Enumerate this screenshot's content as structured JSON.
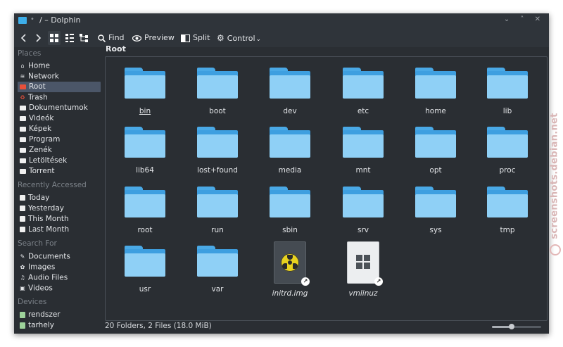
{
  "window": {
    "title": "/ – Dolphin"
  },
  "toolbar": {
    "find_label": "Find",
    "preview_label": "Preview",
    "split_label": "Split",
    "control_label": "Control"
  },
  "sidebar": {
    "places_header": "Places",
    "places": [
      {
        "label": "Home",
        "icon": "home-icon"
      },
      {
        "label": "Network",
        "icon": "network-icon"
      },
      {
        "label": "Root",
        "icon": "red-folder-icon",
        "selected": true
      },
      {
        "label": "Trash",
        "icon": "trash-icon"
      },
      {
        "label": "Dokumentumok",
        "icon": "folder-icon"
      },
      {
        "label": "Videók",
        "icon": "folder-icon"
      },
      {
        "label": "Képek",
        "icon": "folder-icon"
      },
      {
        "label": "Program",
        "icon": "folder-icon"
      },
      {
        "label": "Zenék",
        "icon": "folder-icon"
      },
      {
        "label": "Letöltések",
        "icon": "folder-icon"
      },
      {
        "label": "Torrent",
        "icon": "folder-icon"
      }
    ],
    "recent_header": "Recently Accessed",
    "recent": [
      {
        "label": "Today",
        "icon": "calendar-icon"
      },
      {
        "label": "Yesterday",
        "icon": "calendar-icon"
      },
      {
        "label": "This Month",
        "icon": "calendar-icon"
      },
      {
        "label": "Last Month",
        "icon": "calendar-icon"
      }
    ],
    "search_header": "Search For",
    "search": [
      {
        "label": "Documents",
        "icon": "document-icon"
      },
      {
        "label": "Images",
        "icon": "image-icon"
      },
      {
        "label": "Audio Files",
        "icon": "music-icon"
      },
      {
        "label": "Videos",
        "icon": "video-icon"
      }
    ],
    "devices_header": "Devices",
    "devices": [
      {
        "label": "rendszer",
        "icon": "drive-icon"
      },
      {
        "label": "tarhely",
        "icon": "drive-icon"
      }
    ]
  },
  "breadcrumb": "Root",
  "items": [
    {
      "name": "bin",
      "type": "folder"
    },
    {
      "name": "boot",
      "type": "folder"
    },
    {
      "name": "dev",
      "type": "folder"
    },
    {
      "name": "etc",
      "type": "folder"
    },
    {
      "name": "home",
      "type": "folder"
    },
    {
      "name": "lib",
      "type": "folder"
    },
    {
      "name": "lib64",
      "type": "folder"
    },
    {
      "name": "lost+found",
      "type": "folder"
    },
    {
      "name": "media",
      "type": "folder"
    },
    {
      "name": "mnt",
      "type": "folder"
    },
    {
      "name": "opt",
      "type": "folder"
    },
    {
      "name": "proc",
      "type": "folder"
    },
    {
      "name": "root",
      "type": "folder"
    },
    {
      "name": "run",
      "type": "folder"
    },
    {
      "name": "sbin",
      "type": "folder"
    },
    {
      "name": "srv",
      "type": "folder"
    },
    {
      "name": "sys",
      "type": "folder"
    },
    {
      "name": "tmp",
      "type": "folder"
    },
    {
      "name": "usr",
      "type": "folder"
    },
    {
      "name": "var",
      "type": "folder"
    },
    {
      "name": "initrd.img",
      "type": "symlink",
      "icon": "radiation-icon"
    },
    {
      "name": "vmlinuz",
      "type": "symlink",
      "icon": "windows-icon"
    }
  ],
  "status": {
    "text": "20 Folders, 2 Files (18.0 MiB)",
    "zoom_fraction": 0.4
  },
  "watermark": "screenshots.debian.net",
  "colors": {
    "accent": "#3daee9",
    "folder_front": "#8fd0f6",
    "folder_back": "#3e9fe0",
    "selection": "#4b5668"
  }
}
